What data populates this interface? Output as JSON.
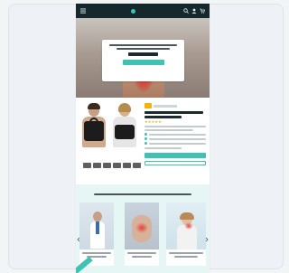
{
  "colors": {
    "accent": "#3fc2b2",
    "header_bg": "#17282c",
    "pain_red": "#e8322a",
    "star": "#f4b400"
  },
  "header": {
    "icons": [
      "menu-icon",
      "search-icon",
      "account-icon",
      "cart-icon"
    ]
  },
  "hero": {
    "cta_icon": "button"
  },
  "product": {
    "rating_stars": 5,
    "thumb_count": 6
  },
  "testimonials": {
    "cards": [
      {
        "image": "doctor"
      },
      {
        "image": "knee-pain"
      },
      {
        "image": "neck-pain"
      }
    ]
  }
}
